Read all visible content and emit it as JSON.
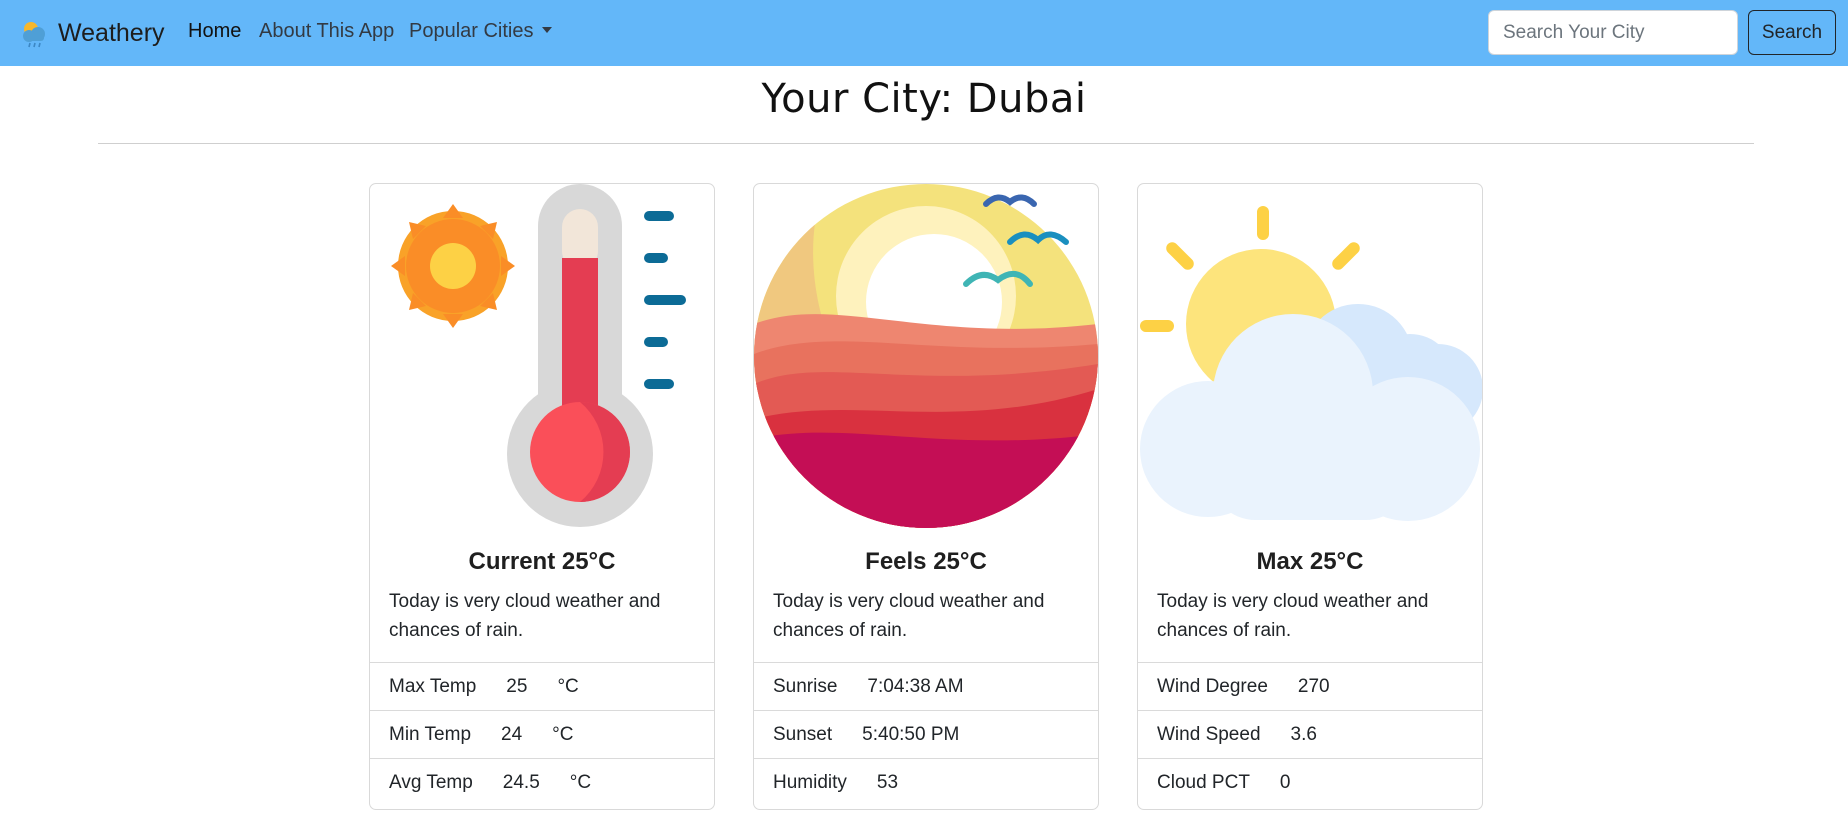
{
  "navbar": {
    "brand": "Weathery",
    "links": [
      {
        "label": "Home",
        "active": true
      },
      {
        "label": "About This App",
        "active": false
      },
      {
        "label": "Popular Cities",
        "active": false,
        "dropdown": true
      }
    ],
    "search": {
      "placeholder": "Search Your City",
      "value": "",
      "button_label": "Search"
    }
  },
  "page": {
    "title": "Your City: Dubai"
  },
  "cards": [
    {
      "image_icon": "thermometer-sun-icon",
      "title": "Current 25°C",
      "text": "Today is very cloud weather and chances of rain.",
      "items": [
        {
          "label": "Max Temp",
          "value": "25",
          "unit": "°C"
        },
        {
          "label": "Min Temp",
          "value": "24",
          "unit": "°C"
        },
        {
          "label": "Avg Temp",
          "value": "24.5",
          "unit": "°C"
        }
      ]
    },
    {
      "image_icon": "desert-sunset-icon",
      "title": "Feels 25°C",
      "text": "Today is very cloud weather and chances of rain.",
      "items": [
        {
          "label": "Sunrise",
          "value": "7:04:38 AM"
        },
        {
          "label": "Sunset",
          "value": "5:40:50 PM"
        },
        {
          "label": "Humidity",
          "value": "53"
        }
      ]
    },
    {
      "image_icon": "sun-cloud-icon",
      "title": "Max 25°C",
      "text": "Today is very cloud weather and chances of rain.",
      "items": [
        {
          "label": "Wind Degree",
          "value": "270"
        },
        {
          "label": "Wind Speed",
          "value": "3.6"
        },
        {
          "label": "Cloud PCT",
          "value": "0"
        }
      ]
    }
  ],
  "colors": {
    "navbar": "#63b7f9",
    "sun": "#fa8d27",
    "thermometer_red": "#e43d52",
    "cloud": "#eaf3fd"
  }
}
